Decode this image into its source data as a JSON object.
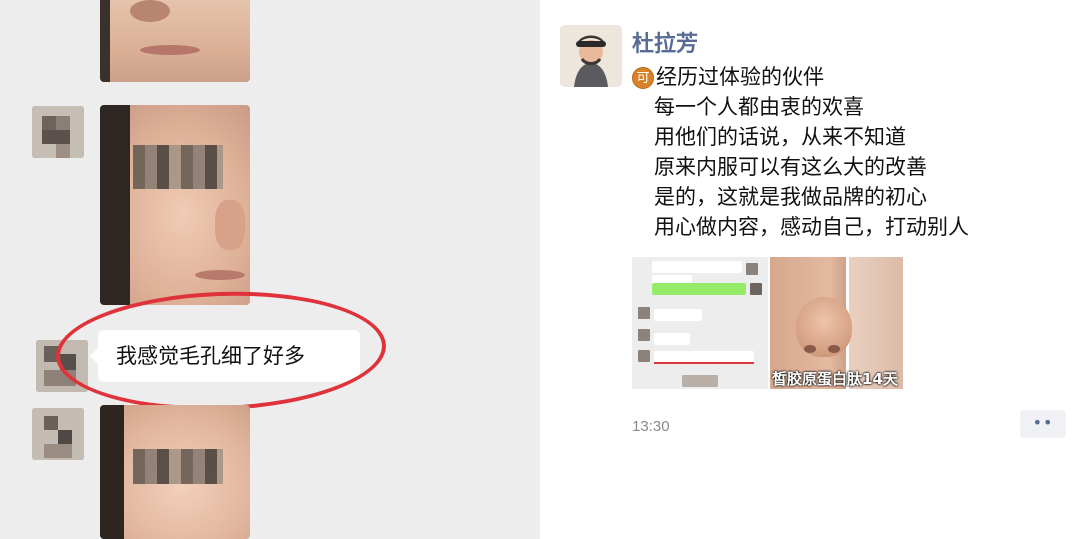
{
  "chat": {
    "bubble_text": "我感觉毛孔细了好多",
    "highlight_color": "#e0323a"
  },
  "post": {
    "author": "杜拉芳",
    "badge": "可",
    "lines": [
      "经历过体验的伙伴",
      "每一个人都由衷的欢喜",
      "用他们的话说，从来不知道",
      "原来内服可以有这么大的改善",
      "是的，这就是我做品牌的初心",
      "用心做内容，感动自己，打动别人"
    ],
    "thumbnail_caption": "皙胶原蛋白肽14天",
    "time": "13:30",
    "more_icon": "ellipsis-icon",
    "name_color": "#576b95"
  }
}
